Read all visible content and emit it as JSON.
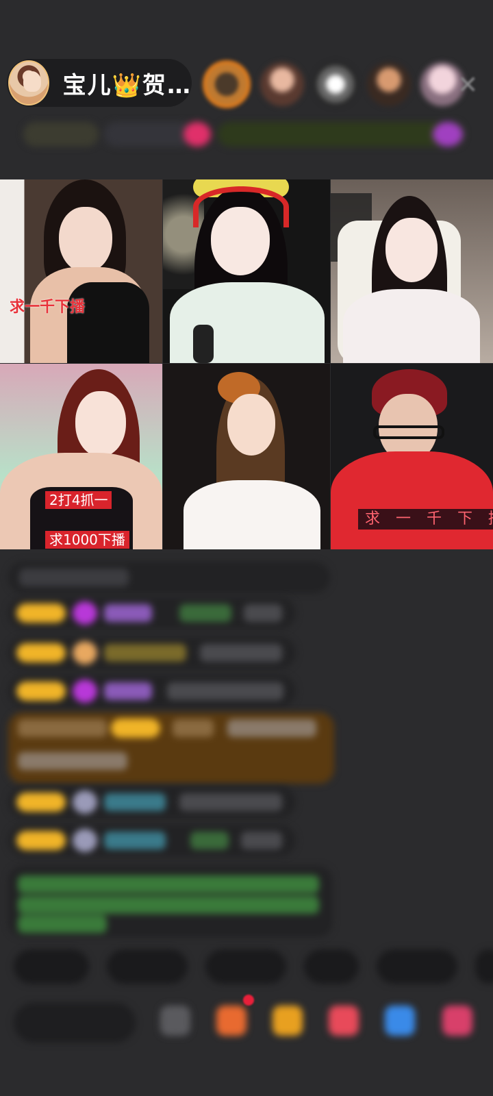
{
  "host": {
    "name": "宝儿👑贺…",
    "avatar_icon": "host-avatar"
  },
  "top_bar": {
    "close_icon": "✕",
    "viewer_avatar_count": 5
  },
  "video_tiles": [
    {
      "id": 1,
      "label": "求一千下播"
    },
    {
      "id": 2,
      "label": ""
    },
    {
      "id": 3,
      "label": ""
    },
    {
      "id": 4,
      "labels": [
        "2打4抓一",
        "求1000下播"
      ]
    },
    {
      "id": 5,
      "label": ""
    },
    {
      "id": 6,
      "label": "求 一 千 下 播"
    }
  ],
  "colors": {
    "background": "#2b2b2d",
    "accent_red": "#e8323a",
    "badge_yellow": "#f0b428",
    "highlight_brown": "#5a3a10"
  },
  "icons": [
    "host-avatar",
    "close-icon",
    "gift-icon",
    "emoji-icon",
    "pk-icon",
    "more-icon"
  ]
}
